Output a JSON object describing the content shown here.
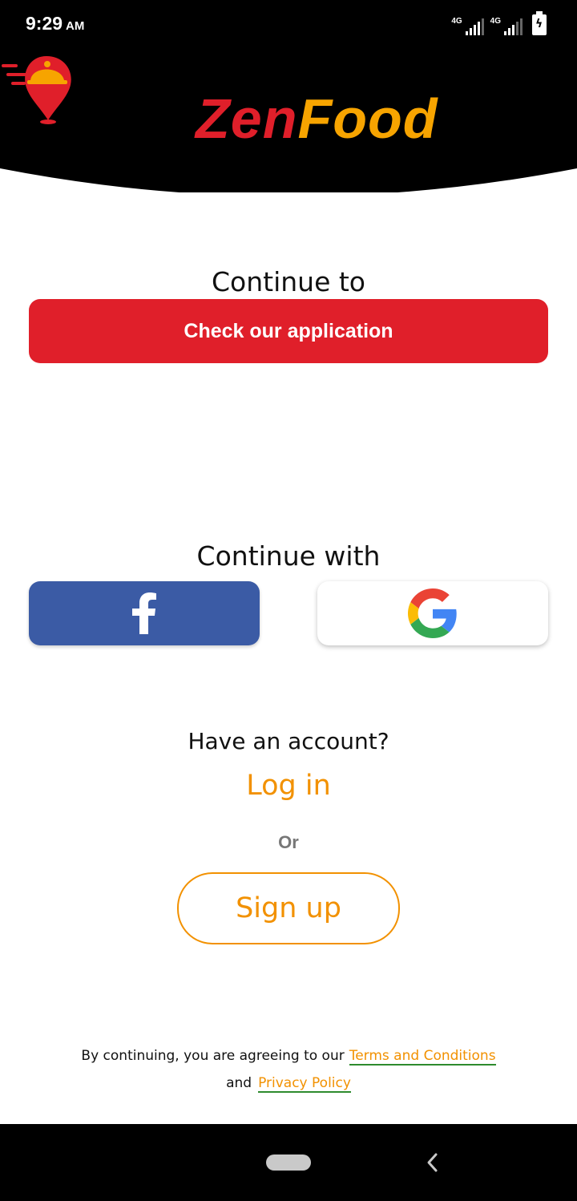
{
  "status_bar": {
    "time": "9:29",
    "ampm": "AM",
    "network_1": "4G",
    "network_2": "4G"
  },
  "brand": {
    "name_part1": "Zen",
    "name_part2": "Food",
    "colors": {
      "red": "#e01f2a",
      "orange": "#f7a400"
    }
  },
  "main": {
    "continue_to": "Continue to",
    "check_app_button": "Check our application",
    "continue_with": "Continue with",
    "facebook_icon": "facebook-icon",
    "google_icon": "google-icon"
  },
  "account": {
    "have_account": "Have an account?",
    "login": "Log in",
    "or": "Or",
    "signup": "Sign up"
  },
  "legal": {
    "prefix": "By continuing, you are agreeing to our",
    "terms": "Terms and Conditions",
    "and": "and",
    "privacy": "Privacy Policy"
  },
  "colors": {
    "primary_red": "#e01f2a",
    "accent_orange": "#f29100",
    "facebook_blue": "#3b5ba5"
  }
}
